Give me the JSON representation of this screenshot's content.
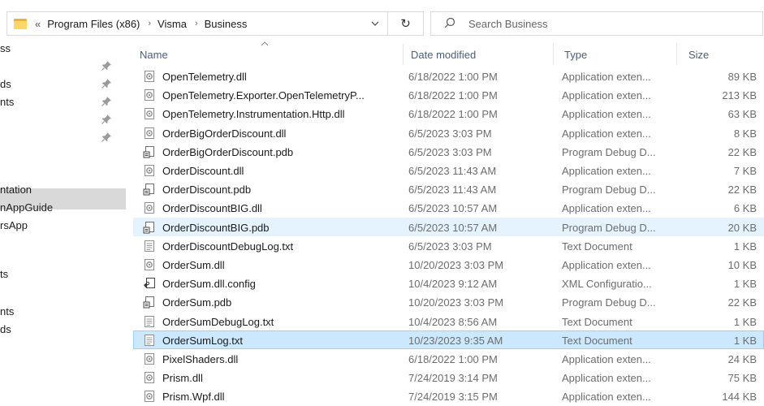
{
  "address_bar": {
    "overflow": "«",
    "crumbs": [
      "Program Files (x86)",
      "Visma",
      "Business"
    ],
    "separator": "›",
    "dropdown": "⌄",
    "refresh": "↻"
  },
  "search": {
    "placeholder": "Search Business"
  },
  "nav": {
    "items": [
      {
        "label": "ss",
        "pinned": false
      },
      {
        "label": "",
        "pinned": true
      },
      {
        "label": "ds",
        "pinned": true
      },
      {
        "label": "nts",
        "pinned": true
      },
      {
        "label": "",
        "pinned": true
      },
      {
        "label": "",
        "pinned": true
      },
      {
        "label": "",
        "pinned": false
      },
      {
        "label": "ntation",
        "pinned": false
      },
      {
        "label": "nAppGuide",
        "pinned": false
      },
      {
        "label": "rsApp",
        "pinned": false
      },
      {
        "label": "ts",
        "pinned": false
      },
      {
        "label": "nts",
        "pinned": false
      },
      {
        "label": "ds",
        "pinned": false
      }
    ]
  },
  "columns": {
    "name": "Name",
    "date": "Date modified",
    "type": "Type",
    "size": "Size"
  },
  "files": [
    {
      "name": "OpenTelemetry.dll",
      "date": "6/18/2022 1:00 PM",
      "type": "Application exten...",
      "size": "89 KB",
      "icon": "dll-icon",
      "state": ""
    },
    {
      "name": "OpenTelemetry.Exporter.OpenTelemetryP...",
      "date": "6/18/2022 1:00 PM",
      "type": "Application exten...",
      "size": "213 KB",
      "icon": "dll-icon",
      "state": ""
    },
    {
      "name": "OpenTelemetry.Instrumentation.Http.dll",
      "date": "6/18/2022 1:00 PM",
      "type": "Application exten...",
      "size": "63 KB",
      "icon": "dll-icon",
      "state": ""
    },
    {
      "name": "OrderBigOrderDiscount.dll",
      "date": "6/5/2023 3:03 PM",
      "type": "Application exten...",
      "size": "8 KB",
      "icon": "dll-icon",
      "state": ""
    },
    {
      "name": "OrderBigOrderDiscount.pdb",
      "date": "6/5/2023 3:03 PM",
      "type": "Program Debug D...",
      "size": "22 KB",
      "icon": "pdb-icon",
      "state": ""
    },
    {
      "name": "OrderDiscount.dll",
      "date": "6/5/2023 11:43 AM",
      "type": "Application exten...",
      "size": "7 KB",
      "icon": "dll-icon",
      "state": ""
    },
    {
      "name": "OrderDiscount.pdb",
      "date": "6/5/2023 11:43 AM",
      "type": "Program Debug D...",
      "size": "22 KB",
      "icon": "pdb-icon",
      "state": ""
    },
    {
      "name": "OrderDiscountBIG.dll",
      "date": "6/5/2023 10:57 AM",
      "type": "Application exten...",
      "size": "6 KB",
      "icon": "dll-icon",
      "state": ""
    },
    {
      "name": "OrderDiscountBIG.pdb",
      "date": "6/5/2023 10:57 AM",
      "type": "Program Debug D...",
      "size": "20 KB",
      "icon": "pdb-icon",
      "state": "hover"
    },
    {
      "name": "OrderDiscountDebugLog.txt",
      "date": "6/5/2023 3:03 PM",
      "type": "Text Document",
      "size": "1 KB",
      "icon": "txt-icon",
      "state": ""
    },
    {
      "name": "OrderSum.dll",
      "date": "10/20/2023 3:03 PM",
      "type": "Application exten...",
      "size": "10 KB",
      "icon": "dll-icon",
      "state": ""
    },
    {
      "name": "OrderSum.dll.config",
      "date": "10/4/2023 9:12 AM",
      "type": "XML Configuratio...",
      "size": "1 KB",
      "icon": "config-icon",
      "state": ""
    },
    {
      "name": "OrderSum.pdb",
      "date": "10/20/2023 3:03 PM",
      "type": "Program Debug D...",
      "size": "22 KB",
      "icon": "pdb-icon",
      "state": ""
    },
    {
      "name": "OrderSumDebugLog.txt",
      "date": "10/4/2023 8:56 AM",
      "type": "Text Document",
      "size": "1 KB",
      "icon": "txt-icon",
      "state": ""
    },
    {
      "name": "OrderSumLog.txt",
      "date": "10/23/2023 9:35 AM",
      "type": "Text Document",
      "size": "1 KB",
      "icon": "txt-icon",
      "state": "selected"
    },
    {
      "name": "PixelShaders.dll",
      "date": "6/18/2022 1:00 PM",
      "type": "Application exten...",
      "size": "24 KB",
      "icon": "dll-icon",
      "state": ""
    },
    {
      "name": "Prism.dll",
      "date": "7/24/2019 3:14 PM",
      "type": "Application exten...",
      "size": "75 KB",
      "icon": "dll-icon",
      "state": ""
    },
    {
      "name": "Prism.Wpf.dll",
      "date": "7/24/2019 3:15 PM",
      "type": "Application exten...",
      "size": "144 KB",
      "icon": "dll-icon",
      "state": ""
    }
  ],
  "colors": {
    "selected_bg": "#cce8ff",
    "selected_border": "#99d1ff",
    "hover_bg": "#e5f3ff",
    "header_text": "#4c607a",
    "secondary_text": "#6d6d6d"
  }
}
